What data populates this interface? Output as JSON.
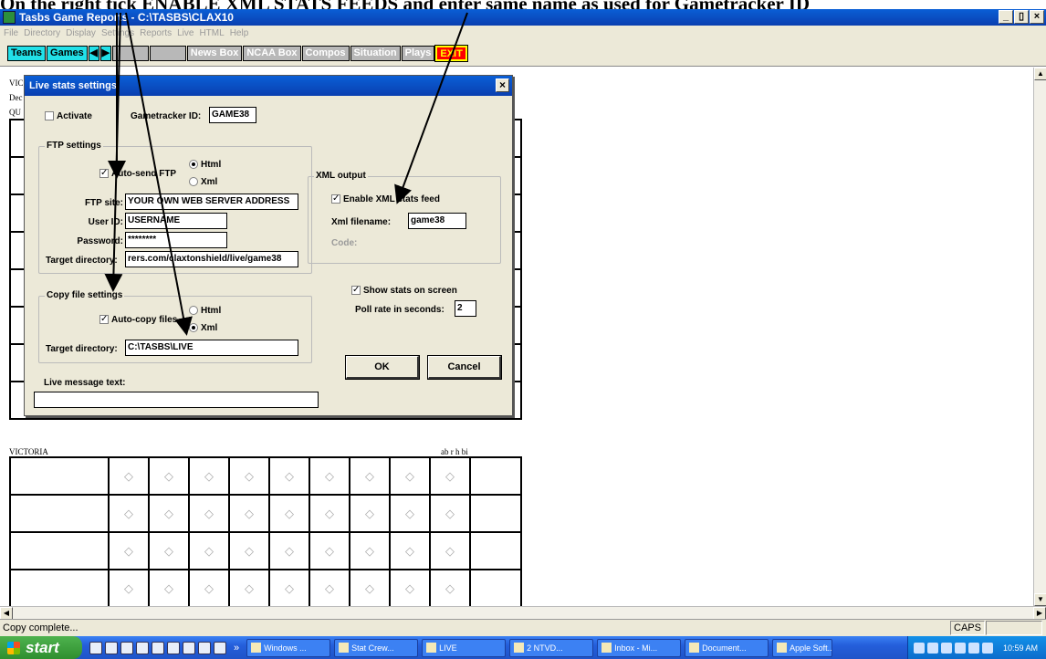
{
  "caption": "On the right tick ENABLE XML STATS FEEDS and enter same name as used for Gametracker ID",
  "window": {
    "title": "Tasbs Game Reports - C:\\TASBS\\CLAX10",
    "buttons": [
      "_",
      "▯",
      "×"
    ]
  },
  "menu": [
    "File",
    "Directory",
    "Display",
    "Settings",
    "Reports",
    "Live",
    "HTML",
    "Help"
  ],
  "toolbar": {
    "teams": "Teams",
    "games": "Games",
    "prev_icon": "◀",
    "next_icon": "▶",
    "news_box": "News Box",
    "ncaa_box": "NCAA Box",
    "compos": "Compos",
    "situation": "Situation",
    "plays": "Plays",
    "exit": "EXIT"
  },
  "report": {
    "team_top_partial": "VIC",
    "date_partial": "Dec",
    "header_top_partial": "QU",
    "team_bottom": "VICTORIA",
    "stat_headers": "ab r h bi",
    "diamond_glyph": "◇"
  },
  "dialog": {
    "title": "Live stats settings",
    "close": "×",
    "activate_label": "Activate",
    "activate_checked": false,
    "gametracker_label": "Gametracker ID:",
    "gametracker_value": "GAME38",
    "ftp": {
      "legend": "FTP settings",
      "auto_send_label": "Auto-send FTP",
      "auto_send_checked": true,
      "html_label": "Html",
      "xml_label": "Xml",
      "selected": "Html",
      "site_label": "FTP site:",
      "site_value": "YOUR OWN WEB SERVER ADDRESS",
      "user_label": "User ID:",
      "user_value": "USERNAME",
      "password_label": "Password:",
      "password_value": "********",
      "target_label": "Target directory:",
      "target_value": "rers.com/claxtonshield/live/game38"
    },
    "xml": {
      "legend": "XML output",
      "enable_label": "Enable XML stats feed",
      "enable_checked": true,
      "filename_label": "Xml filename:",
      "filename_value": "game38",
      "code_label": "Code:"
    },
    "show_stats_label": "Show stats on screen",
    "show_stats_checked": true,
    "poll_label": "Poll rate in seconds:",
    "poll_value": "2",
    "copy": {
      "legend": "Copy file settings",
      "auto_copy_label": "Auto-copy files",
      "auto_copy_checked": true,
      "html_label": "Html",
      "xml_label": "Xml",
      "selected": "Xml",
      "target_label": "Target directory:",
      "target_value": "C:\\TASBS\\LIVE"
    },
    "ok": "OK",
    "cancel": "Cancel",
    "live_msg_label": "Live message text:",
    "live_msg_value": ""
  },
  "status": {
    "message": "Copy complete...",
    "caps": "CAPS"
  },
  "taskbar": {
    "start": "start",
    "chevron": "»",
    "tasks": [
      "Windows ...",
      "Stat Crew...",
      "LIVE",
      "2 NTVD...",
      "Inbox - Mi...",
      "Document...",
      "Apple Soft..."
    ],
    "clock": "10:59 AM"
  },
  "colors": {
    "titlebar": "#0a4fc4",
    "toolbar_cyan": "#22e0e8",
    "exit_red": "#ff0000",
    "dialog_bg": "#ece9d8"
  }
}
